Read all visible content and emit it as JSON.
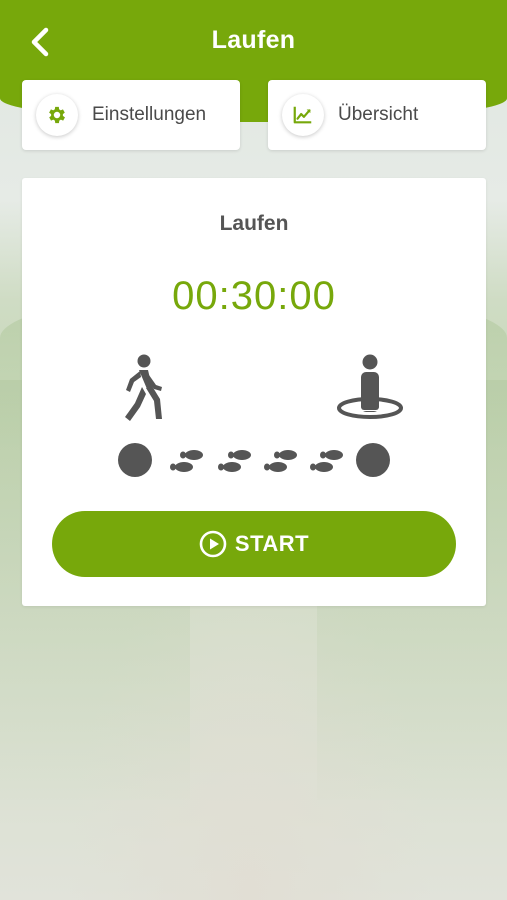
{
  "header": {
    "title": "Laufen",
    "back_icon": "chevron-left-icon",
    "color": "#77a80b"
  },
  "toolbar": {
    "settings": {
      "label": "Einstellungen",
      "icon": "gear-icon"
    },
    "overview": {
      "label": "Übersicht",
      "icon": "line-chart-icon"
    }
  },
  "card": {
    "title": "Laufen",
    "timer": "00:30:00",
    "start_icon": "walking-person-icon",
    "end_icon": "standing-person-icon",
    "track_icons": "footprints-icon",
    "start_button": {
      "label": "START",
      "icon": "play-circle-icon"
    }
  },
  "colors": {
    "accent": "#77a80b",
    "icon_gray": "#555555",
    "text": "#4a4a4a"
  }
}
